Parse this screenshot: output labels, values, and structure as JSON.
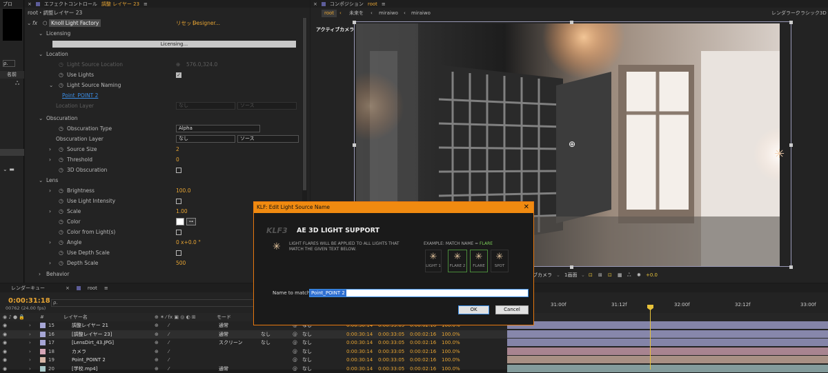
{
  "project_panel": {
    "tab": "プロ",
    "name_header": "名前"
  },
  "effect_controls": {
    "tab_title": "エフェクトコントロール",
    "tab_layer": "調整 レイヤー 23",
    "breadcrumb": "root・調整レイヤー 23",
    "effect_name": "Knoll Light Factory",
    "reset": "リセット",
    "designer": "Designer...",
    "licensing_group": "Licensing",
    "licensing_button": "Licensing...",
    "location_group": "Location",
    "light_source_location": "Light Source Location",
    "light_source_location_value": "576.0,324.0",
    "use_lights": "Use Lights",
    "light_source_naming": "Light Source Naming",
    "naming_value": "Point_POINT 2",
    "location_layer": "Location Layer",
    "location_layer_value": "なし",
    "location_layer_source": "ソース",
    "obscuration_group": "Obscuration",
    "obscuration_type": "Obscuration Type",
    "obscuration_type_value": "Alpha",
    "obscuration_layer": "Obscuration Layer",
    "obscuration_layer_value": "なし",
    "obscuration_layer_source": "ソース",
    "source_size": "Source Size",
    "source_size_value": "2",
    "threshold": "Threshold",
    "threshold_value": "0",
    "obscuration_3d": "3D Obscuration",
    "lens_group": "Lens",
    "brightness": "Brightness",
    "brightness_value": "100.0",
    "use_light_intensity": "Use Light Intensity",
    "scale": "Scale",
    "scale_value": "1.00",
    "color": "Color",
    "color_from_light": "Color from Light(s)",
    "angle": "Angle",
    "angle_value": "0 x+0.0 °",
    "use_depth_scale": "Use Depth Scale",
    "depth_scale": "Depth Scale",
    "depth_scale_value": "500",
    "behavior_group": "Behavior"
  },
  "composition": {
    "tab_title": "コンポジション",
    "tab_name": "root",
    "crumbs": [
      "root",
      "未来を",
      "miraiwo",
      "miraiwo"
    ],
    "renderer_label": "レンダラー：",
    "renderer_value": "クラシック3D",
    "active_camera": "アクティブカメラ",
    "footer_camera": "ブカメラ",
    "footer_view": "1画面",
    "footer_exposure": "+0.0"
  },
  "dialog": {
    "title": "KLF: Edit Light Source Name",
    "logo": "KLF3",
    "heading": "AE 3D LIGHT SUPPORT",
    "description": "LIGHT FLARES WILL BE APPLIED TO ALL LIGHTS THAT MATCH THE GIVEN TEXT BELOW.",
    "example_prefix": "EXAMPLE: MATCH NAME =",
    "example_match": "FLARE",
    "examples": [
      "LIGHT 1",
      "FLARE 2",
      "FLARE",
      "SPOT"
    ],
    "name_label": "Name to match:",
    "name_value": "Point_POINT 2",
    "ok": "OK",
    "cancel": "Cancel"
  },
  "timeline": {
    "render_queue_tab": "レンダーキュー",
    "root_tab": "root",
    "timecode": "0:00:31:18",
    "frame_info": "00762 (24.00 fps)",
    "layer_name_header": "レイヤー名",
    "mode_header": "モード",
    "ruler": [
      "31:00f",
      "31:12f",
      "32:00f",
      "32:12f",
      "33:00f"
    ],
    "layers": [
      {
        "num": "15",
        "name": "調整レイヤー 21",
        "mode": "通常",
        "trk": "",
        "parent": "なし",
        "in": "0:00:30:14",
        "out": "0:00:33:05",
        "dur": "0:00:02:16",
        "stretch": "100.0%",
        "color": "#a6a6d6"
      },
      {
        "num": "16",
        "name": "[調整レイヤー 23]",
        "mode": "通常",
        "trk": "なし",
        "parent": "なし",
        "in": "0:00:30:14",
        "out": "0:00:33:05",
        "dur": "0:00:02:16",
        "stretch": "100.0%",
        "color": "#a6a6d6"
      },
      {
        "num": "17",
        "name": "[LensDirt_43.JPG]",
        "mode": "スクリーン",
        "trk": "なし",
        "parent": "なし",
        "in": "0:00:30:14",
        "out": "0:00:33:05",
        "dur": "0:00:02:16",
        "stretch": "100.0%",
        "color": "#a6a6d6"
      },
      {
        "num": "18",
        "name": "カメラ",
        "mode": "",
        "trk": "",
        "parent": "なし",
        "in": "0:00:30:14",
        "out": "0:00:33:05",
        "dur": "0:00:02:16",
        "stretch": "100.0%",
        "color": "#d6a6b6"
      },
      {
        "num": "19",
        "name": "Point_POINT 2",
        "mode": "",
        "trk": "",
        "parent": "なし",
        "in": "0:00:30:14",
        "out": "0:00:33:05",
        "dur": "0:00:02:16",
        "stretch": "100.0%",
        "color": "#d6b6a6"
      },
      {
        "num": "20",
        "name": "[学校.mp4]",
        "mode": "通常",
        "trk": "",
        "parent": "なし",
        "in": "0:00:30:14",
        "out": "0:00:33:05",
        "dur": "0:00:02:16",
        "stretch": "100.0%",
        "color": "#a6c6c6"
      }
    ]
  }
}
